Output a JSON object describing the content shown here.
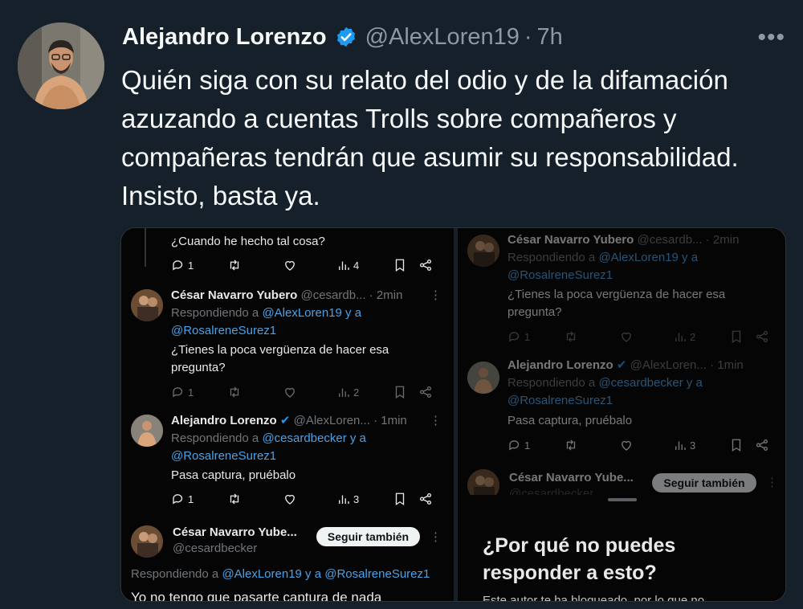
{
  "tweet": {
    "author_name": "Alejandro Lorenzo",
    "author_handle": "@AlexLoren19",
    "separator": "·",
    "time": "7h",
    "more": "•••",
    "text": "Quién siga con su relato del odio y de la difamación azuzando a cuentas Trolls sobre compañeros y compañeras tendrán que asumir su responsabilidad. Insisto, basta ya."
  },
  "colors": {
    "background": "#15202b",
    "link": "#4aa2e8",
    "verified": "#1d9bf0"
  },
  "left": {
    "top_text": "¿Cuando he hecho tal cosa?",
    "top_stats": {
      "replies": "1",
      "views": "4"
    },
    "r1": {
      "name": "César Navarro Yubero",
      "handle": "@cesardb...",
      "time": "· 2min",
      "replying": "Respondiendo a",
      "mention1": "@AlexLoren19 y a",
      "mention2": "@RosalreneSurez1",
      "line1": "¿Tienes la poca vergüenza de hacer esa",
      "line2": "pregunta?",
      "replies": "1",
      "views": "2"
    },
    "r2": {
      "name": "Alejandro Lorenzo",
      "handle": "@AlexLoren...",
      "time": "· 1min",
      "replying": "Respondiendo a",
      "mention1": "@cesardbecker y a",
      "mention2": "@RosalreneSurez1",
      "text": "Pasa captura, pruébalo",
      "replies": "1",
      "views": "3"
    },
    "r3": {
      "name": "César Navarro Yube...",
      "handle": "@cesardbecker",
      "follow": "Seguir también",
      "replying": "Respondiendo a",
      "mention": "@AlexLoren19 y a @RosalreneSurez1",
      "text": "Yo no tengo que pasarte captura de nada"
    }
  },
  "right": {
    "r1": {
      "name": "César Navarro Yubero",
      "handle": "@cesardb...",
      "time": "· 2min",
      "replying": "Respondiendo a",
      "mention1": "@AlexLoren19 y a",
      "mention2": "@RosalreneSurez1",
      "line1": "¿Tienes la poca vergüenza de hacer esa",
      "line2": "pregunta?",
      "replies": "1",
      "views": "2"
    },
    "r2": {
      "name": "Alejandro Lorenzo",
      "handle": "@AlexLoren...",
      "time": "· 1min",
      "replying": "Respondiendo a",
      "mention1": "@cesardbecker y a",
      "mention2": "@RosalreneSurez1",
      "text": "Pasa captura, pruébalo",
      "replies": "1",
      "views": "3"
    },
    "r3": {
      "name": "César Navarro Yube...",
      "handle": "@cesardbecker",
      "follow": "Seguir también"
    },
    "blocked_title1": "¿Por qué no puedes",
    "blocked_title2": "responder a esto?",
    "blocked_body": "Este autor te ha bloqueado, por lo que no"
  }
}
